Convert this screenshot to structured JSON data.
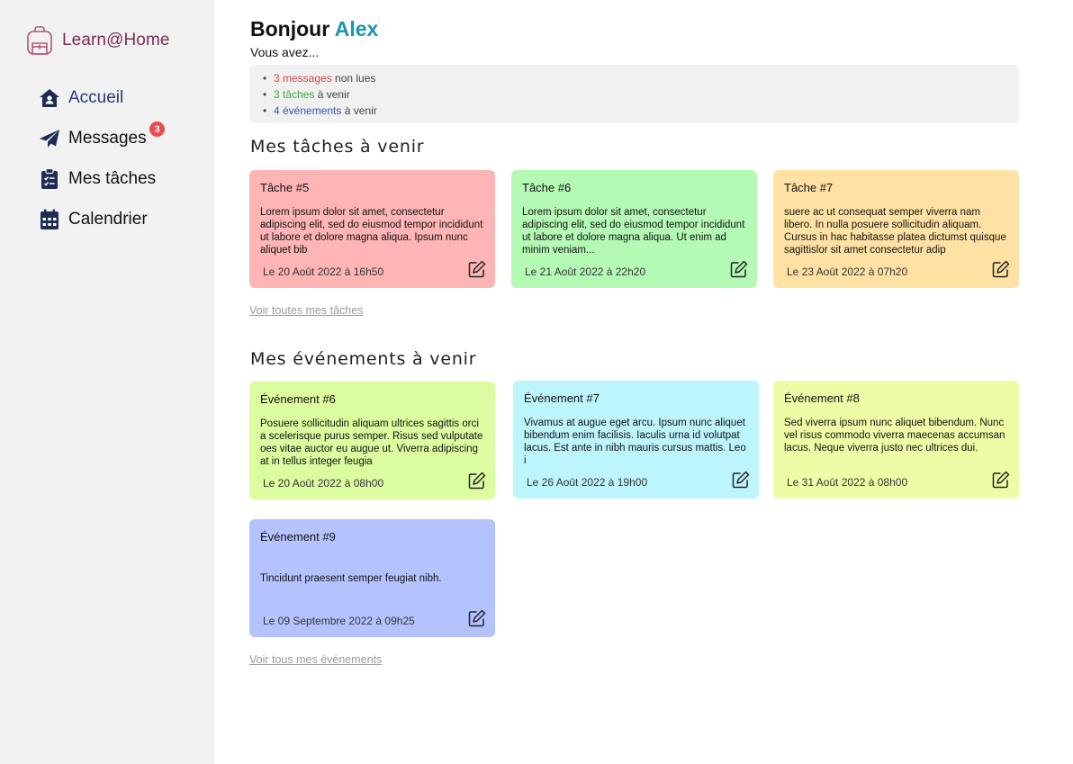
{
  "brand": {
    "label": "Learn@Home",
    "icon": "backpack-icon",
    "color": "#7b2d55"
  },
  "nav": {
    "items": [
      {
        "label": "Accueil",
        "icon": "home-icon",
        "active": true
      },
      {
        "label": "Messages",
        "icon": "paper-plane-icon",
        "badge": "3"
      },
      {
        "label": "Mes tâches",
        "icon": "clipboard-check-icon"
      },
      {
        "label": "Calendrier",
        "icon": "calendar-icon"
      }
    ]
  },
  "header": {
    "greeting": "Bonjour",
    "name": "Alex",
    "subtitle": "Vous avez..."
  },
  "summary": {
    "messages_count": "3 messages",
    "messages_suffix": " non lues",
    "tasks_count": "3 tâches",
    "tasks_suffix": " à venir",
    "events_count": "4 événements",
    "events_suffix": " à venir"
  },
  "tasks": {
    "title": "Mes tâches à venir",
    "see_all": "Voir toutes mes tâches",
    "cards": [
      {
        "title": "Tâche #5",
        "body": "Lorem ipsum dolor sit amet, consectetur adipiscing elit, sed do eiusmod tempor incididunt ut labore et dolore magna aliqua. Ipsum nunc aliquet bib",
        "date": "Le 20 Août 2022 à 16h50",
        "color": "#ffb5b5"
      },
      {
        "title": "Tâche #6",
        "body": "Lorem ipsum dolor sit amet, consectetur adipiscing elit, sed do eiusmod tempor incididunt ut labore et dolore magna aliqua. Ut enim ad minim veniam...",
        "date": "Le 21 Août 2022 à 22h20",
        "color": "#b4fab4"
      },
      {
        "title": "Tâche #7",
        "body": "suere ac ut consequat semper viverra nam libero. In nulla posuere sollicitudin aliquam. Cursus in hac habitasse platea dictumst quisque sagittislor sit amet consectetur adip",
        "date": "Le 23 Août 2022 à 07h20",
        "color": "#ffe2a3"
      }
    ]
  },
  "events": {
    "title": "Mes événements à venir",
    "see_all": "Voir tous mes événements",
    "cards": [
      {
        "title": "Événement #6",
        "body": "Posuere sollicitudin aliquam ultrices sagittis orci a scelerisque purus semper. Risus sed vulputate oes vitae auctor eu augue ut. Viverra adipiscing at in tellus integer feugia",
        "date": "Le 20 Août 2022 à 08h00",
        "color": "#dcfca0"
      },
      {
        "title": "Événement #7",
        "body": "Vivamus at augue eget arcu. Ipsum nunc aliquet bibendum enim facilisis. Iaculis urna id volutpat lacus. Est ante in nibh mauris cursus mattis. Leo i",
        "date": "Le 26 Août 2022 à 19h00",
        "color": "#bdf5fd"
      },
      {
        "title": "Événement #8",
        "body": "Sed viverra ipsum nunc aliquet bibendum. Nunc vel risus commodo viverra maecenas accumsan lacus. Neque viverra justo nec ultrices dui.",
        "date": "Le 31 Août 2022 à 08h00",
        "color": "#effca6"
      },
      {
        "title": "Événement #9",
        "body": "Tincidunt praesent semper feugiat nibh.",
        "date": "Le 09 Septembre 2022 à 09h25",
        "color": "#b4c3fd"
      }
    ]
  }
}
